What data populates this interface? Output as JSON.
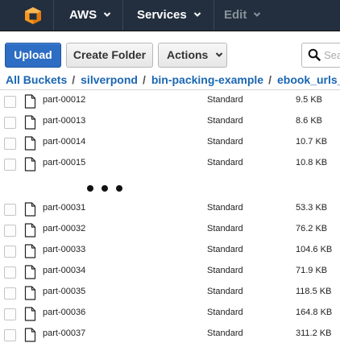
{
  "topnav": {
    "logo_icon": "aws-cube-icon",
    "aws_label": "AWS",
    "services_label": "Services",
    "edit_label": "Edit"
  },
  "toolbar": {
    "upload_label": "Upload",
    "create_folder_label": "Create Folder",
    "actions_label": "Actions",
    "search_placeholder": "Search"
  },
  "breadcrumb": [
    "All Buckets",
    "silverpond",
    "bin-packing-example",
    "ebook_urls_"
  ],
  "files_top": [
    {
      "name": "part-00012",
      "storage_class": "Standard",
      "size": "9.5 KB"
    },
    {
      "name": "part-00013",
      "storage_class": "Standard",
      "size": "8.6 KB"
    },
    {
      "name": "part-00014",
      "storage_class": "Standard",
      "size": "10.7 KB"
    },
    {
      "name": "part-00015",
      "storage_class": "Standard",
      "size": "10.8 KB"
    }
  ],
  "files_bottom": [
    {
      "name": "part-00031",
      "storage_class": "Standard",
      "size": "53.3 KB"
    },
    {
      "name": "part-00032",
      "storage_class": "Standard",
      "size": "76.2 KB"
    },
    {
      "name": "part-00033",
      "storage_class": "Standard",
      "size": "104.6 KB"
    },
    {
      "name": "part-00034",
      "storage_class": "Standard",
      "size": "71.9 KB"
    },
    {
      "name": "part-00035",
      "storage_class": "Standard",
      "size": "118.5 KB"
    },
    {
      "name": "part-00036",
      "storage_class": "Standard",
      "size": "164.8 KB"
    },
    {
      "name": "part-00037",
      "storage_class": "Standard",
      "size": "311.2 KB"
    }
  ],
  "colors": {
    "nav_bg": "#232f3e",
    "primary_button": "#2d6dc3",
    "link": "#1a66b3"
  }
}
